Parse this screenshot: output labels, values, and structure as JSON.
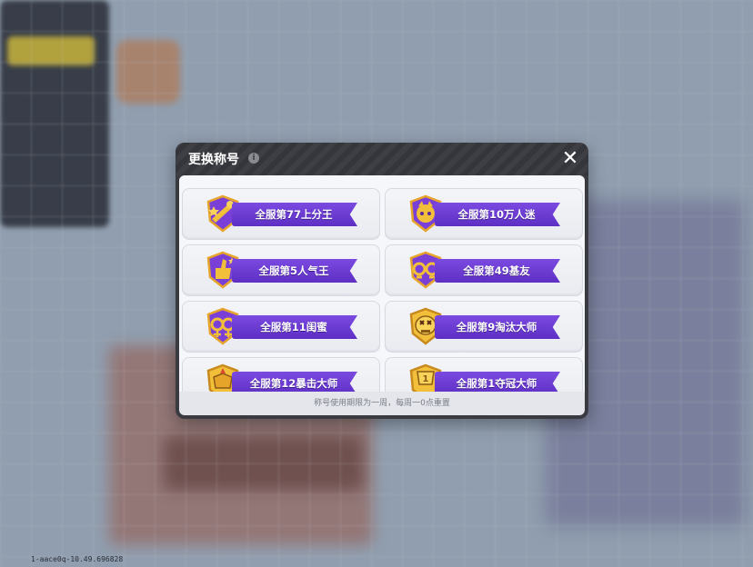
{
  "modal": {
    "title": "更换称号",
    "info_glyph": "i",
    "close_glyph": "✕",
    "footer_note": "称号使用期限为一周，每周一0点重置"
  },
  "titles": [
    {
      "label": "全服第77上分王",
      "icon": "rocket-trophy-icon"
    },
    {
      "label": "全服第10万人迷",
      "icon": "heart-hands-icon"
    },
    {
      "label": "全服第5人气王",
      "icon": "thumbs-up-icon"
    },
    {
      "label": "全服第49基友",
      "icon": "friends-icon"
    },
    {
      "label": "全服第11闺蜜",
      "icon": "bestie-icon"
    },
    {
      "label": "全服第9淘汰大师",
      "icon": "skull-icon"
    },
    {
      "label": "全服第12暴击大师",
      "icon": "fist-icon"
    },
    {
      "label": "全服第1夺冠大师",
      "icon": "cup-icon"
    }
  ],
  "version_text": "1-aace0q-10.49.696828",
  "colors": {
    "ribbon": "#6a38d4",
    "badge_gold": "#e6a52a",
    "header_dark": "#3a3b40"
  }
}
